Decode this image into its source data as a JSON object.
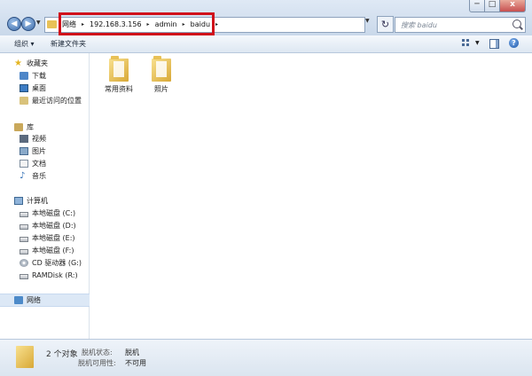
{
  "window": {
    "controls": {
      "minimize": "─",
      "maximize": "□",
      "close": "x"
    }
  },
  "nav": {
    "back": "◀",
    "forward": "▶",
    "dropdown": "▼",
    "refresh": "↻"
  },
  "address": {
    "crumbs": [
      "网络",
      "192.168.3.156",
      "admin",
      "baidu"
    ],
    "separator": "▸",
    "dropdown": "▼"
  },
  "search": {
    "placeholder": "搜索 baidu"
  },
  "toolbar": {
    "organize": "组织 ▾",
    "new_folder": "新建文件夹",
    "view_dropdown": "▼",
    "help": "?"
  },
  "sidebar": {
    "favorites": {
      "label": "收藏夹",
      "items": [
        "下载",
        "桌面",
        "最近访问的位置"
      ]
    },
    "libraries": {
      "label": "库",
      "items": [
        "视频",
        "图片",
        "文档",
        "音乐"
      ]
    },
    "computer": {
      "label": "计算机",
      "items": [
        "本地磁盘 (C:)",
        "本地磁盘 (D:)",
        "本地磁盘 (E:)",
        "本地磁盘 (F:)",
        "CD 驱动器 (G:)",
        "RAMDisk (R:)"
      ]
    },
    "network": {
      "label": "网络"
    }
  },
  "files": [
    {
      "name": "常用资料",
      "icon": "folder-icon"
    },
    {
      "name": "照片",
      "icon": "folder-icon"
    }
  ],
  "status": {
    "count": "2 个对象",
    "offline_status_label": "脱机状态:",
    "offline_status_value": "脱机",
    "offline_avail_label": "脱机可用性:",
    "offline_avail_value": "不可用"
  },
  "colors": {
    "highlight_border": "#d0101a",
    "folder": "#e8c157",
    "accent": "#3b6aa8"
  }
}
